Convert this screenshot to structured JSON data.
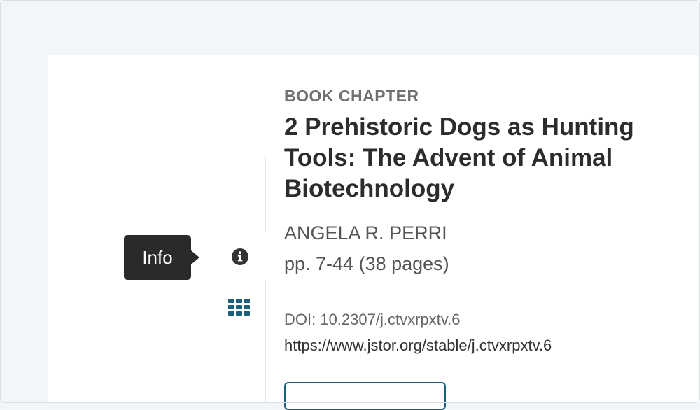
{
  "sidebar": {
    "tooltip_label": "Info",
    "tabs": [
      {
        "name": "info",
        "icon": "info-circle-icon",
        "active": true
      },
      {
        "name": "grid",
        "icon": "grid-icon",
        "active": false
      }
    ]
  },
  "chapter": {
    "type_label": "BOOK CHAPTER",
    "title": "2 Prehistoric Dogs as Hunting Tools: The Advent of Animal Biotechnology",
    "author": "ANGELA R. PERRI",
    "pages": "pp. 7-44 (38 pages)",
    "doi": "DOI: 10.2307/j.ctvxrpxtv.6",
    "stable_url": "https://www.jstor.org/stable/j.ctvxrpxtv.6"
  },
  "colors": {
    "accent": "#1d5f7a",
    "page_background": "#f3f6f9",
    "tooltip_background": "#2a2a2a"
  }
}
